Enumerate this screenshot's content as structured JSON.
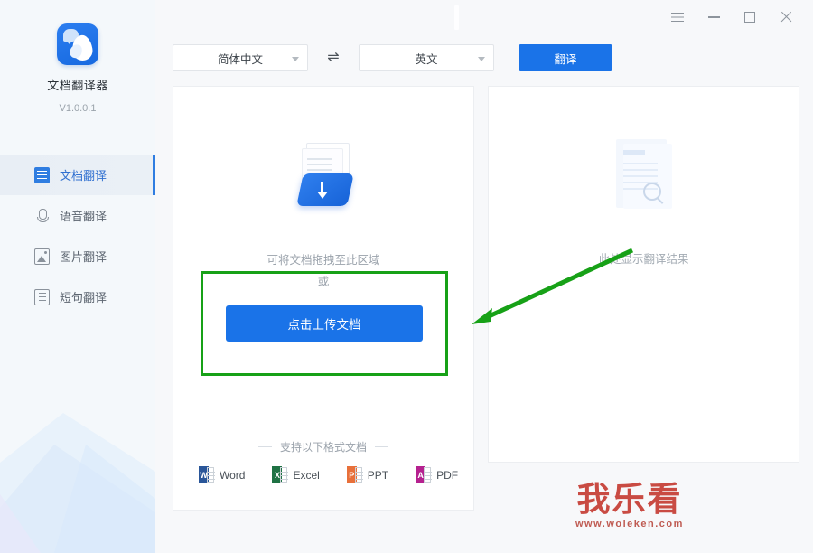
{
  "app": {
    "name": "文档翻译器",
    "version": "V1.0.0.1",
    "logo_icon": "dove-speech-bubble-app-icon"
  },
  "sidebar": {
    "items": [
      {
        "label": "文档翻译",
        "icon": "document-icon",
        "active": true
      },
      {
        "label": "语音翻译",
        "icon": "microphone-icon",
        "active": false
      },
      {
        "label": "图片翻译",
        "icon": "image-icon",
        "active": false
      },
      {
        "label": "短句翻译",
        "icon": "list-icon",
        "active": false
      }
    ]
  },
  "titlebar": {
    "menu_icon": "hamburger-menu-icon",
    "minimize_icon": "minimize-icon",
    "maximize_icon": "maximize-icon",
    "close_icon": "close-icon"
  },
  "toolbar": {
    "source_language": "简体中文",
    "target_language": "英文",
    "swap_icon": "⇌",
    "translate_label": "翻译",
    "accent_color": "#1a73e8"
  },
  "left_panel": {
    "upload_icon": "upload-document-icon",
    "drop_hint": "可将文档拖拽至此区域",
    "or_text": "或",
    "upload_button_label": "点击上传文档",
    "formats_title": "支持以下格式文档",
    "formats": [
      {
        "label": "Word",
        "letter": "W",
        "color": "#2a5699"
      },
      {
        "label": "Excel",
        "letter": "X",
        "color": "#1f7244"
      },
      {
        "label": "PPT",
        "letter": "P",
        "color": "#e8703a"
      },
      {
        "label": "PDF",
        "letter": "A",
        "color": "#b5218f"
      }
    ]
  },
  "right_panel": {
    "result_icon": "document-search-icon",
    "placeholder": "此处显示翻译结果"
  },
  "annotation": {
    "color": "#17a117",
    "box_label": "upload-area-highlight",
    "arrow_label": "pointer-arrow-to-upload-button"
  },
  "watermark": {
    "main": "我乐看",
    "sub": "www.woleken.com",
    "color": "#c94b43"
  }
}
